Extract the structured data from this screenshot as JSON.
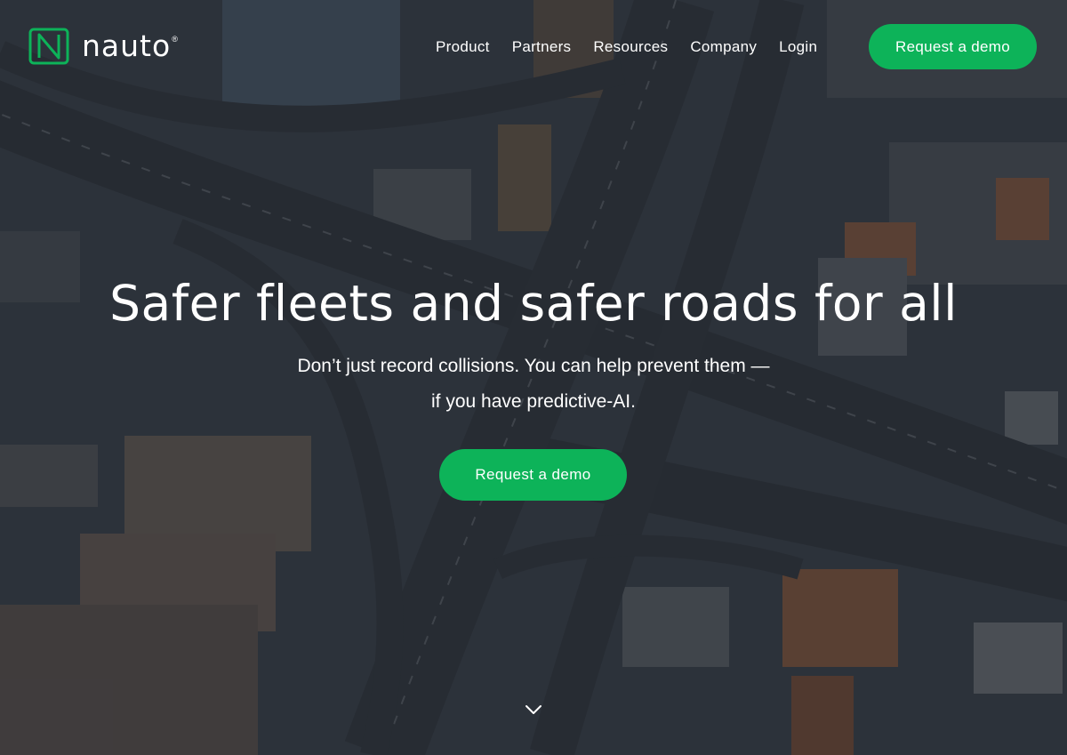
{
  "brand": {
    "name": "nauto",
    "registered_mark": "®",
    "logo_icon": "nauto-n-icon",
    "accent_color": "#0db359"
  },
  "nav": {
    "items": [
      {
        "label": "Product"
      },
      {
        "label": "Partners"
      },
      {
        "label": "Resources"
      },
      {
        "label": "Company"
      },
      {
        "label": "Login"
      }
    ],
    "cta_label": "Request a demo"
  },
  "hero": {
    "headline": "Safer fleets and safer roads for all",
    "subtext_line1": "Don’t just record collisions. You can help prevent them —",
    "subtext_line2": "if you have predictive-AI.",
    "cta_label": "Request a demo",
    "background": "aerial-highway-interchange-image",
    "scroll_icon": "chevron-down-icon"
  }
}
